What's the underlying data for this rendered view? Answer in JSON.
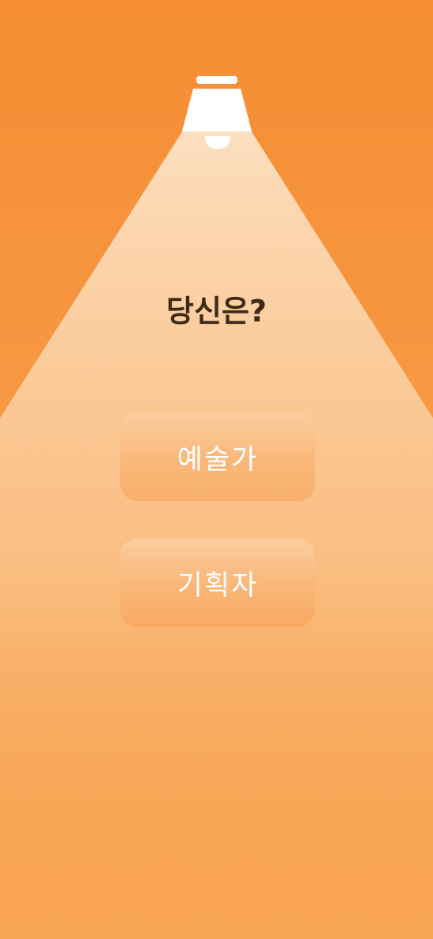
{
  "question": "당신은?",
  "choices": [
    {
      "label": "예술가"
    },
    {
      "label": "기획자"
    }
  ],
  "colors": {
    "background_top": "#f68d33",
    "background_bottom": "#f8a552",
    "question_text": "#3e2a18",
    "button_text": "#ffffff",
    "lamp": "#ffffff"
  },
  "icons": {
    "lamp": "ceiling-lamp-icon"
  }
}
